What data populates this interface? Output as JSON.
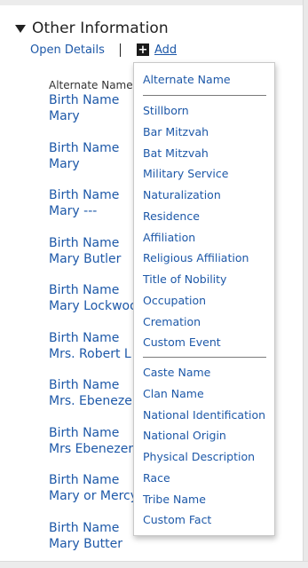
{
  "section": {
    "title": "Other Information",
    "open_details": "Open Details",
    "add_label": "Add",
    "add_icon": "plus-box-icon"
  },
  "list": {
    "column_header": "Alternate Name",
    "items": [
      {
        "line1": "Birth Name",
        "line2": "Mary"
      },
      {
        "line1": "Birth Name",
        "line2": "Mary"
      },
      {
        "line1": "Birth Name",
        "line2": "Mary ---"
      },
      {
        "line1": "Birth Name",
        "line2": "Mary Butler"
      },
      {
        "line1": "Birth Name",
        "line2": "Mary Lockwood"
      },
      {
        "line1": "Birth Name",
        "line2": "Mrs. Robert L"
      },
      {
        "line1": "Birth Name",
        "line2": "Mrs. Ebenezer"
      },
      {
        "line1": "Birth Name",
        "line2": "Mrs Ebenezer"
      },
      {
        "line1": "Birth Name",
        "line2": "Mary or Mercy"
      },
      {
        "line1": "Birth Name",
        "line2": "Mary Butter"
      }
    ]
  },
  "menu": {
    "group1": [
      "Alternate Name"
    ],
    "group2": [
      "Stillborn",
      "Bar Mitzvah",
      "Bat Mitzvah",
      "Military Service",
      "Naturalization",
      "Residence",
      "Affiliation",
      "Religious Affiliation",
      "Title of Nobility",
      "Occupation",
      "Cremation",
      "Custom Event"
    ],
    "group3": [
      "Caste Name",
      "Clan Name",
      "National Identification",
      "National Origin",
      "Physical Description",
      "Race",
      "Tribe Name",
      "Custom Fact"
    ]
  },
  "colors": {
    "link": "#1d58a8",
    "text": "#222222"
  }
}
